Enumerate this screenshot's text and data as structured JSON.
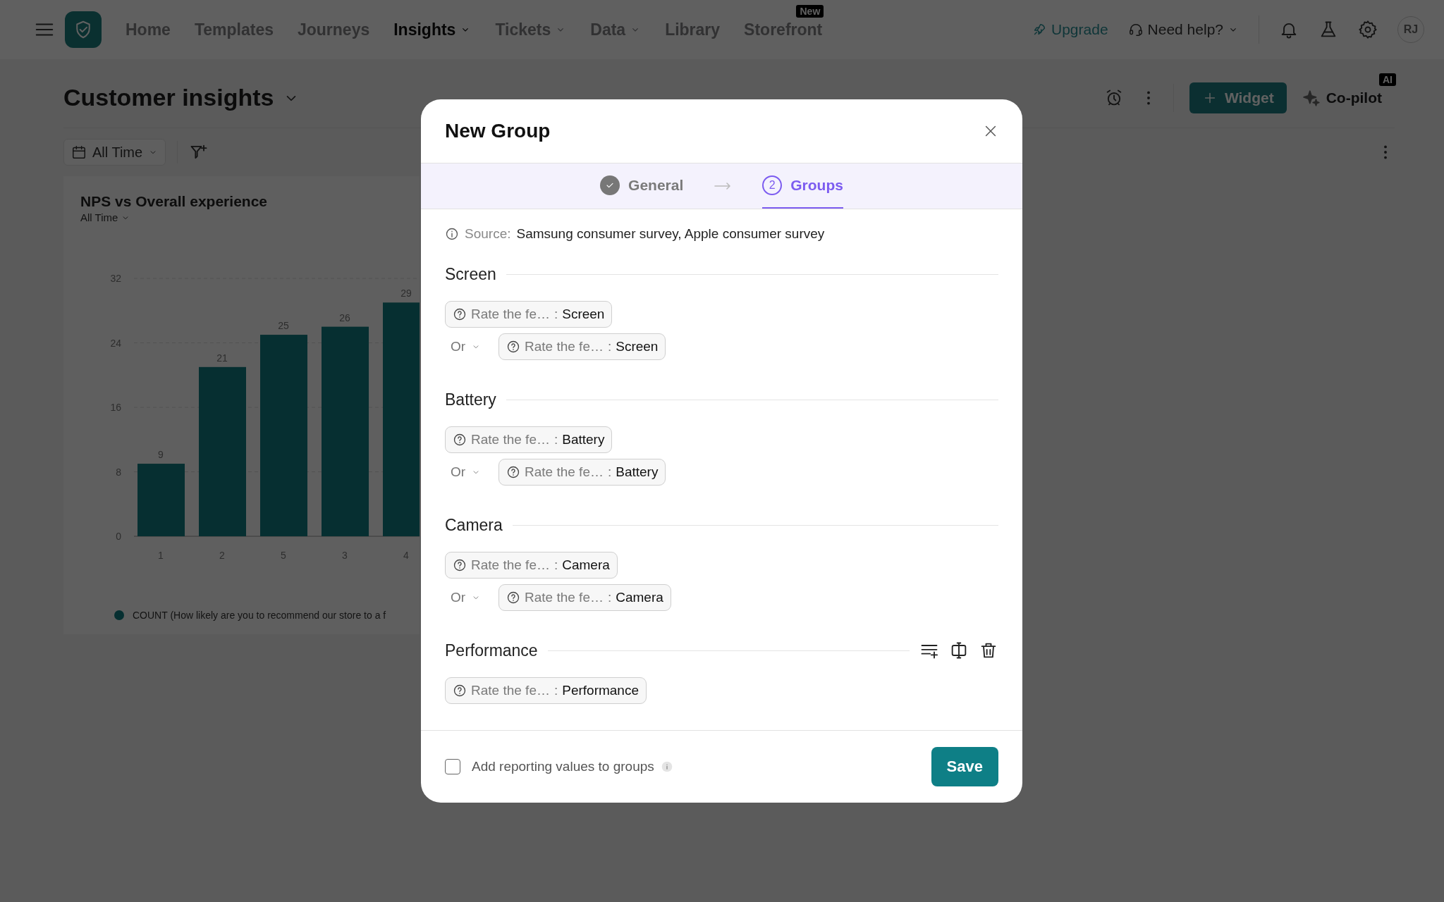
{
  "nav": {
    "items": [
      {
        "label": "Home",
        "selected": false,
        "dropdown": false
      },
      {
        "label": "Templates",
        "selected": false,
        "dropdown": false
      },
      {
        "label": "Journeys",
        "selected": false,
        "dropdown": false
      },
      {
        "label": "Insights",
        "selected": true,
        "dropdown": true
      },
      {
        "label": "Tickets",
        "selected": false,
        "dropdown": true
      },
      {
        "label": "Data",
        "selected": false,
        "dropdown": true
      },
      {
        "label": "Library",
        "selected": false,
        "dropdown": false
      },
      {
        "label": "Storefront",
        "selected": false,
        "dropdown": false,
        "badge": "New"
      }
    ],
    "upgrade": "Upgrade",
    "help": "Need help?",
    "avatar": "RJ"
  },
  "page": {
    "title": "Customer insights",
    "widget_button": "Widget",
    "copilot": "Co-pilot",
    "copilot_badge": "AI",
    "date_filter": "All Time"
  },
  "card": {
    "title": "NPS vs Overall experience",
    "period": "All Time",
    "chart_data": {
      "type": "bar",
      "categories": [
        "1",
        "2",
        "5",
        "3",
        "4"
      ],
      "ylim": [
        0,
        32
      ],
      "yticks": [
        0,
        8,
        16,
        24,
        32
      ],
      "data_labels": true,
      "grid": true,
      "series": [
        {
          "name": "COUNT (How likely are you to recommend our store to a f",
          "color": "#127d80",
          "values": [
            9,
            21,
            25,
            26,
            29
          ]
        }
      ]
    }
  },
  "dialog": {
    "title": "New Group",
    "steps": [
      {
        "label": "General",
        "completed": true,
        "selected": false
      },
      {
        "label": "Groups",
        "number": "2",
        "completed": false,
        "selected": true
      }
    ],
    "source_label": "Source:",
    "source": "Samsung consumer survey, Apple consumer survey",
    "groups": [
      {
        "name": "Screen",
        "show_actions": false,
        "conditions": [
          {
            "question": "Rate the fe…",
            "separator": ":",
            "value": "Screen"
          },
          {
            "connector": "Or",
            "question": "Rate the fe…",
            "separator": ":",
            "value": "Screen"
          }
        ]
      },
      {
        "name": "Battery",
        "show_actions": false,
        "conditions": [
          {
            "question": "Rate the fe…",
            "separator": ":",
            "value": "Battery"
          },
          {
            "connector": "Or",
            "question": "Rate the fe…",
            "separator": ":",
            "value": "Battery"
          }
        ]
      },
      {
        "name": "Camera",
        "show_actions": false,
        "conditions": [
          {
            "question": "Rate the fe…",
            "separator": ":",
            "value": "Camera"
          },
          {
            "connector": "Or",
            "question": "Rate the fe…",
            "separator": ":",
            "value": "Camera"
          }
        ]
      },
      {
        "name": "Performance",
        "show_actions": true,
        "conditions": [
          {
            "question": "Rate the fe…",
            "separator": ":",
            "value": "Performance"
          }
        ]
      }
    ],
    "checkbox": {
      "label": "Add reporting values to groups",
      "checked": false
    },
    "save": "Save"
  }
}
